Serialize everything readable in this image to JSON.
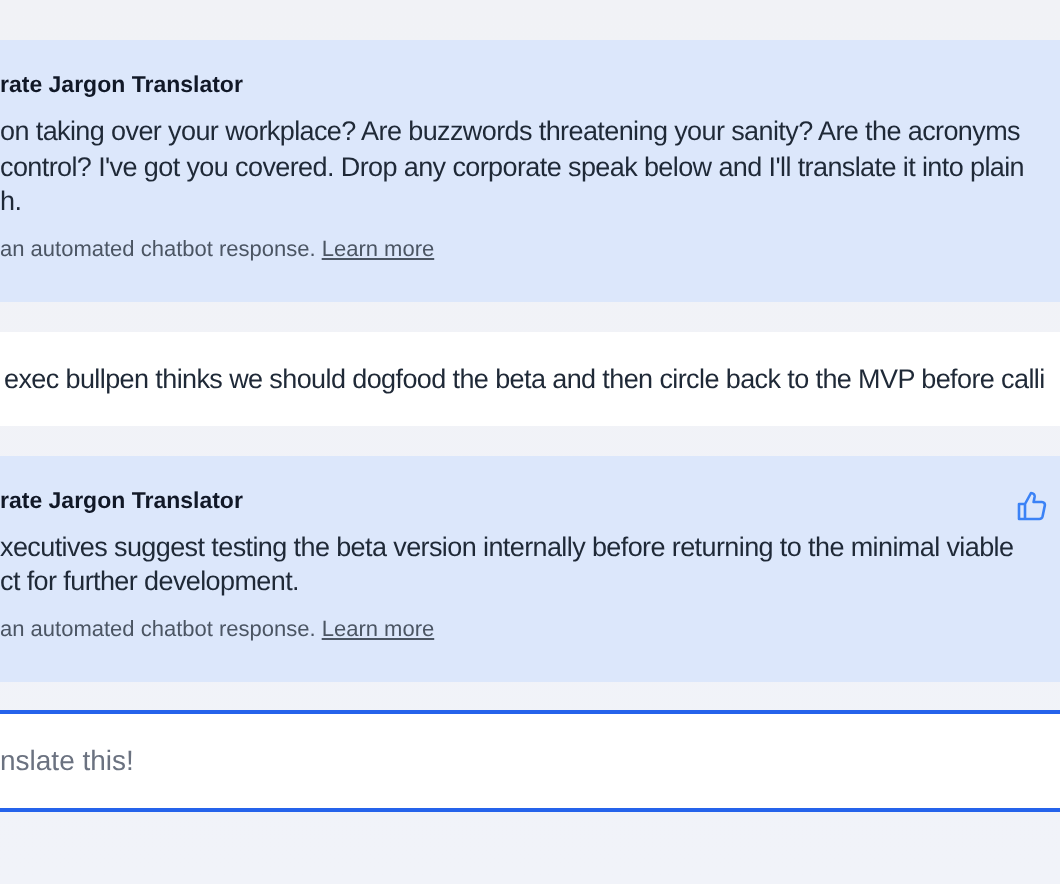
{
  "messages": [
    {
      "kind": "bot",
      "sender": "rate Jargon Translator",
      "lines": [
        "on taking over your workplace? Are buzzwords threatening your sanity? Are the acronyms",
        "control? I've got you covered. Drop any corporate speak below and I'll translate it into plain",
        "h."
      ],
      "note": "an automated chatbot response.",
      "link": "Learn more",
      "feedback": false
    },
    {
      "kind": "user",
      "lines": [
        "exec bullpen thinks we should dogfood the beta and then circle back to the MVP before calli"
      ]
    },
    {
      "kind": "bot",
      "sender": "rate Jargon Translator",
      "lines": [
        "xecutives suggest testing the beta version internally before returning to the minimal viable",
        "ct for further development."
      ],
      "note": "an automated chatbot response.",
      "link": "Learn more",
      "feedback": true
    }
  ],
  "composer": {
    "placeholder": "nslate this!"
  }
}
